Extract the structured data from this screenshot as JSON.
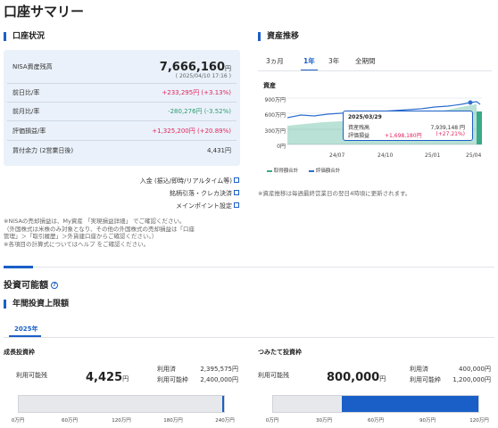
{
  "page_title": "口座サマリー",
  "account": {
    "title": "口座状況",
    "nisa_label": "NISA資産残高",
    "nisa_value": "7,666,160",
    "unit": "円",
    "timestamp": "( 2025/04/10 17:16 )",
    "rows": [
      {
        "label": "前日比/率",
        "value": "+233,295円 (+3.13%)",
        "tone": "red"
      },
      {
        "label": "前月比/率",
        "value": "-280,276円 (-3.52%)",
        "tone": "green"
      },
      {
        "label": "評価損益/率",
        "value": "+1,325,200円 (+20.89%)",
        "tone": "red"
      },
      {
        "label": "買付余力 (2営業日後)",
        "value": "4,431円",
        "tone": "plain"
      }
    ],
    "links": [
      "入金 (振込/即時/リアルタイム等)",
      "銘柄引落・クレカ決済",
      "メインポイント設定"
    ],
    "notes": [
      "※NISAの売却損益は、My資産 「実現損益詳細」 でご確認ください。",
      "（外国株式は米株のみ対象となり、その他の外国株式の売却損益は「口座",
      "管理」＞「取引履歴」＞外貨建口座からご確認ください。）",
      "※各項目の計算式についてはヘルプ をご確認ください。"
    ]
  },
  "trend": {
    "title": "資産推移",
    "tabs": [
      "3ヵ月",
      "1年",
      "3年",
      "全期間"
    ],
    "active_tab": "1年",
    "y_title": "資産",
    "y_ticks": [
      "900万円",
      "600万円",
      "300万円",
      "0円"
    ],
    "x_ticks": [
      "24/07",
      "24/10",
      "25/01",
      "25/04"
    ],
    "tooltip": {
      "date": "2025/03/29",
      "asset_label": "資産残高",
      "asset_value": "7,939,148 円",
      "pl_label": "評価損益",
      "pl_value": "+1,698,180円",
      "pl_rate": "(+27.21%)"
    },
    "legend": [
      "取得額合計",
      "評価額合計"
    ],
    "note": "※資産推移は毎週最終営業日の翌日4時頃に更新されます。",
    "colors": {
      "fill": "#3aaa88",
      "line": "#2f6fd0"
    }
  },
  "invest": {
    "title": "投資可能額",
    "annual_title": "年間投資上限額",
    "year_tab": "2025年",
    "growth": {
      "title": "成長投資枠",
      "avail_label": "利用可能残",
      "avail_value": "4,425",
      "unit": "円",
      "used_label": "利用済",
      "used_value": "2,395,575円",
      "limit_label": "利用可能枠",
      "limit_value": "2,400,000円",
      "fill_fraction": 0.998,
      "ticks": [
        "0万円",
        "60万円",
        "120万円",
        "180万円",
        "240万円"
      ]
    },
    "tsumitate": {
      "title": "つみたて投資枠",
      "avail_label": "利用可能残",
      "avail_value": "800,000",
      "unit": "円",
      "used_label": "利用済",
      "used_value": "400,000円",
      "limit_label": "利用可能枠",
      "limit_value": "1,200,000円",
      "used_fraction": 0.333,
      "ticks": [
        "0万円",
        "30万円",
        "60万円",
        "90万円",
        "120万円"
      ]
    }
  }
}
